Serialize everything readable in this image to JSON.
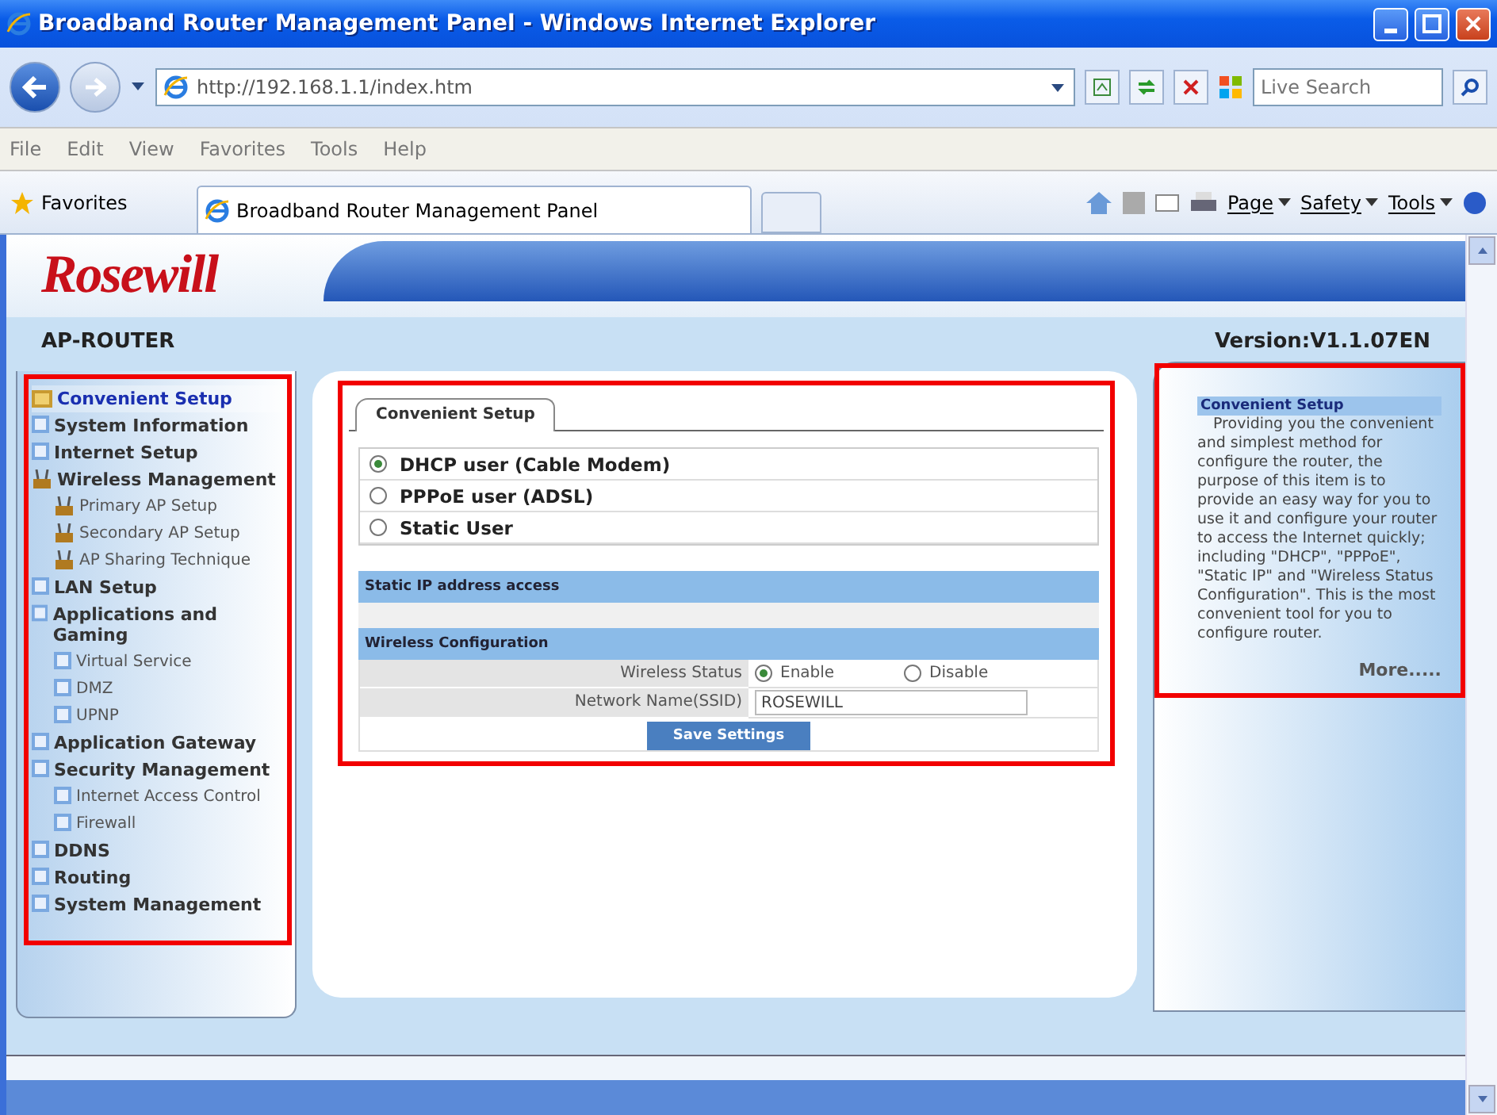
{
  "window": {
    "title": "Broadband Router Management Panel - Windows Internet Explorer"
  },
  "address_bar": {
    "url": "http://192.168.1.1/index.htm",
    "search_placeholder": "Live Search"
  },
  "menu": [
    "File",
    "Edit",
    "View",
    "Favorites",
    "Tools",
    "Help"
  ],
  "favorites_bar": {
    "favorites": "Favorites",
    "tab": "Broadband Router Management Panel",
    "commands": [
      "Page",
      "Safety",
      "Tools"
    ]
  },
  "header": {
    "logo": "Rosewill",
    "model": "AP-ROUTER",
    "version": "Version:V1.1.07EN"
  },
  "sidebar": {
    "items": [
      {
        "label": "Convenient Setup",
        "kind": "folder",
        "selected": true
      },
      {
        "label": "System Information",
        "kind": "page",
        "selected": false
      },
      {
        "label": "Internet Setup",
        "kind": "page",
        "selected": false
      },
      {
        "label": "Wireless Management",
        "kind": "wireless",
        "selected": false,
        "children": [
          {
            "label": "Primary AP Setup",
            "kind": "wireless",
            "selected": false
          },
          {
            "label": "Secondary AP Setup",
            "kind": "wireless",
            "selected": false
          },
          {
            "label": "AP Sharing Technique",
            "kind": "wireless",
            "selected": false
          }
        ]
      },
      {
        "label": "LAN Setup",
        "kind": "page",
        "selected": false
      },
      {
        "label": "Applications and Gaming",
        "kind": "page",
        "selected": false,
        "children": [
          {
            "label": "Virtual Service",
            "kind": "page",
            "selected": false
          },
          {
            "label": "DMZ",
            "kind": "page",
            "selected": false
          },
          {
            "label": "UPNP",
            "kind": "page",
            "selected": false
          }
        ]
      },
      {
        "label": "Application Gateway",
        "kind": "page",
        "selected": false
      },
      {
        "label": "Security Management",
        "kind": "page",
        "selected": false,
        "children": [
          {
            "label": "Internet Access Control",
            "kind": "page",
            "selected": false
          },
          {
            "label": "Firewall",
            "kind": "page",
            "selected": false
          }
        ]
      },
      {
        "label": "DDNS",
        "kind": "page",
        "selected": false
      },
      {
        "label": "Routing",
        "kind": "page",
        "selected": false
      },
      {
        "label": "System Management",
        "kind": "page",
        "selected": false
      }
    ]
  },
  "main": {
    "tab": "Convenient Setup",
    "connection_types": [
      {
        "label": "DHCP user (Cable Modem)",
        "selected": true
      },
      {
        "label": "PPPoE user (ADSL)",
        "selected": false
      },
      {
        "label": "Static User",
        "selected": false
      }
    ],
    "static_ip_heading": "Static IP address access",
    "wireless_heading": "Wireless Configuration",
    "wireless_status": {
      "label": "Wireless Status",
      "options": [
        {
          "label": "Enable",
          "selected": true
        },
        {
          "label": "Disable",
          "selected": false
        }
      ]
    },
    "ssid": {
      "label": "Network Name(SSID)",
      "value": "ROSEWILL"
    },
    "save_button": "Save Settings"
  },
  "help": {
    "title": "Convenient Setup",
    "body": "Providing you the convenient and simplest method for configure the router, the purpose of this item is to provide an easy way for you to use it and configure your router to access the Internet quickly; including \"DHCP\", \"PPPoE\", \"Static IP\" and \"Wireless Status Configuration\". This is the most convenient tool for you to configure router.",
    "more": "More....."
  }
}
